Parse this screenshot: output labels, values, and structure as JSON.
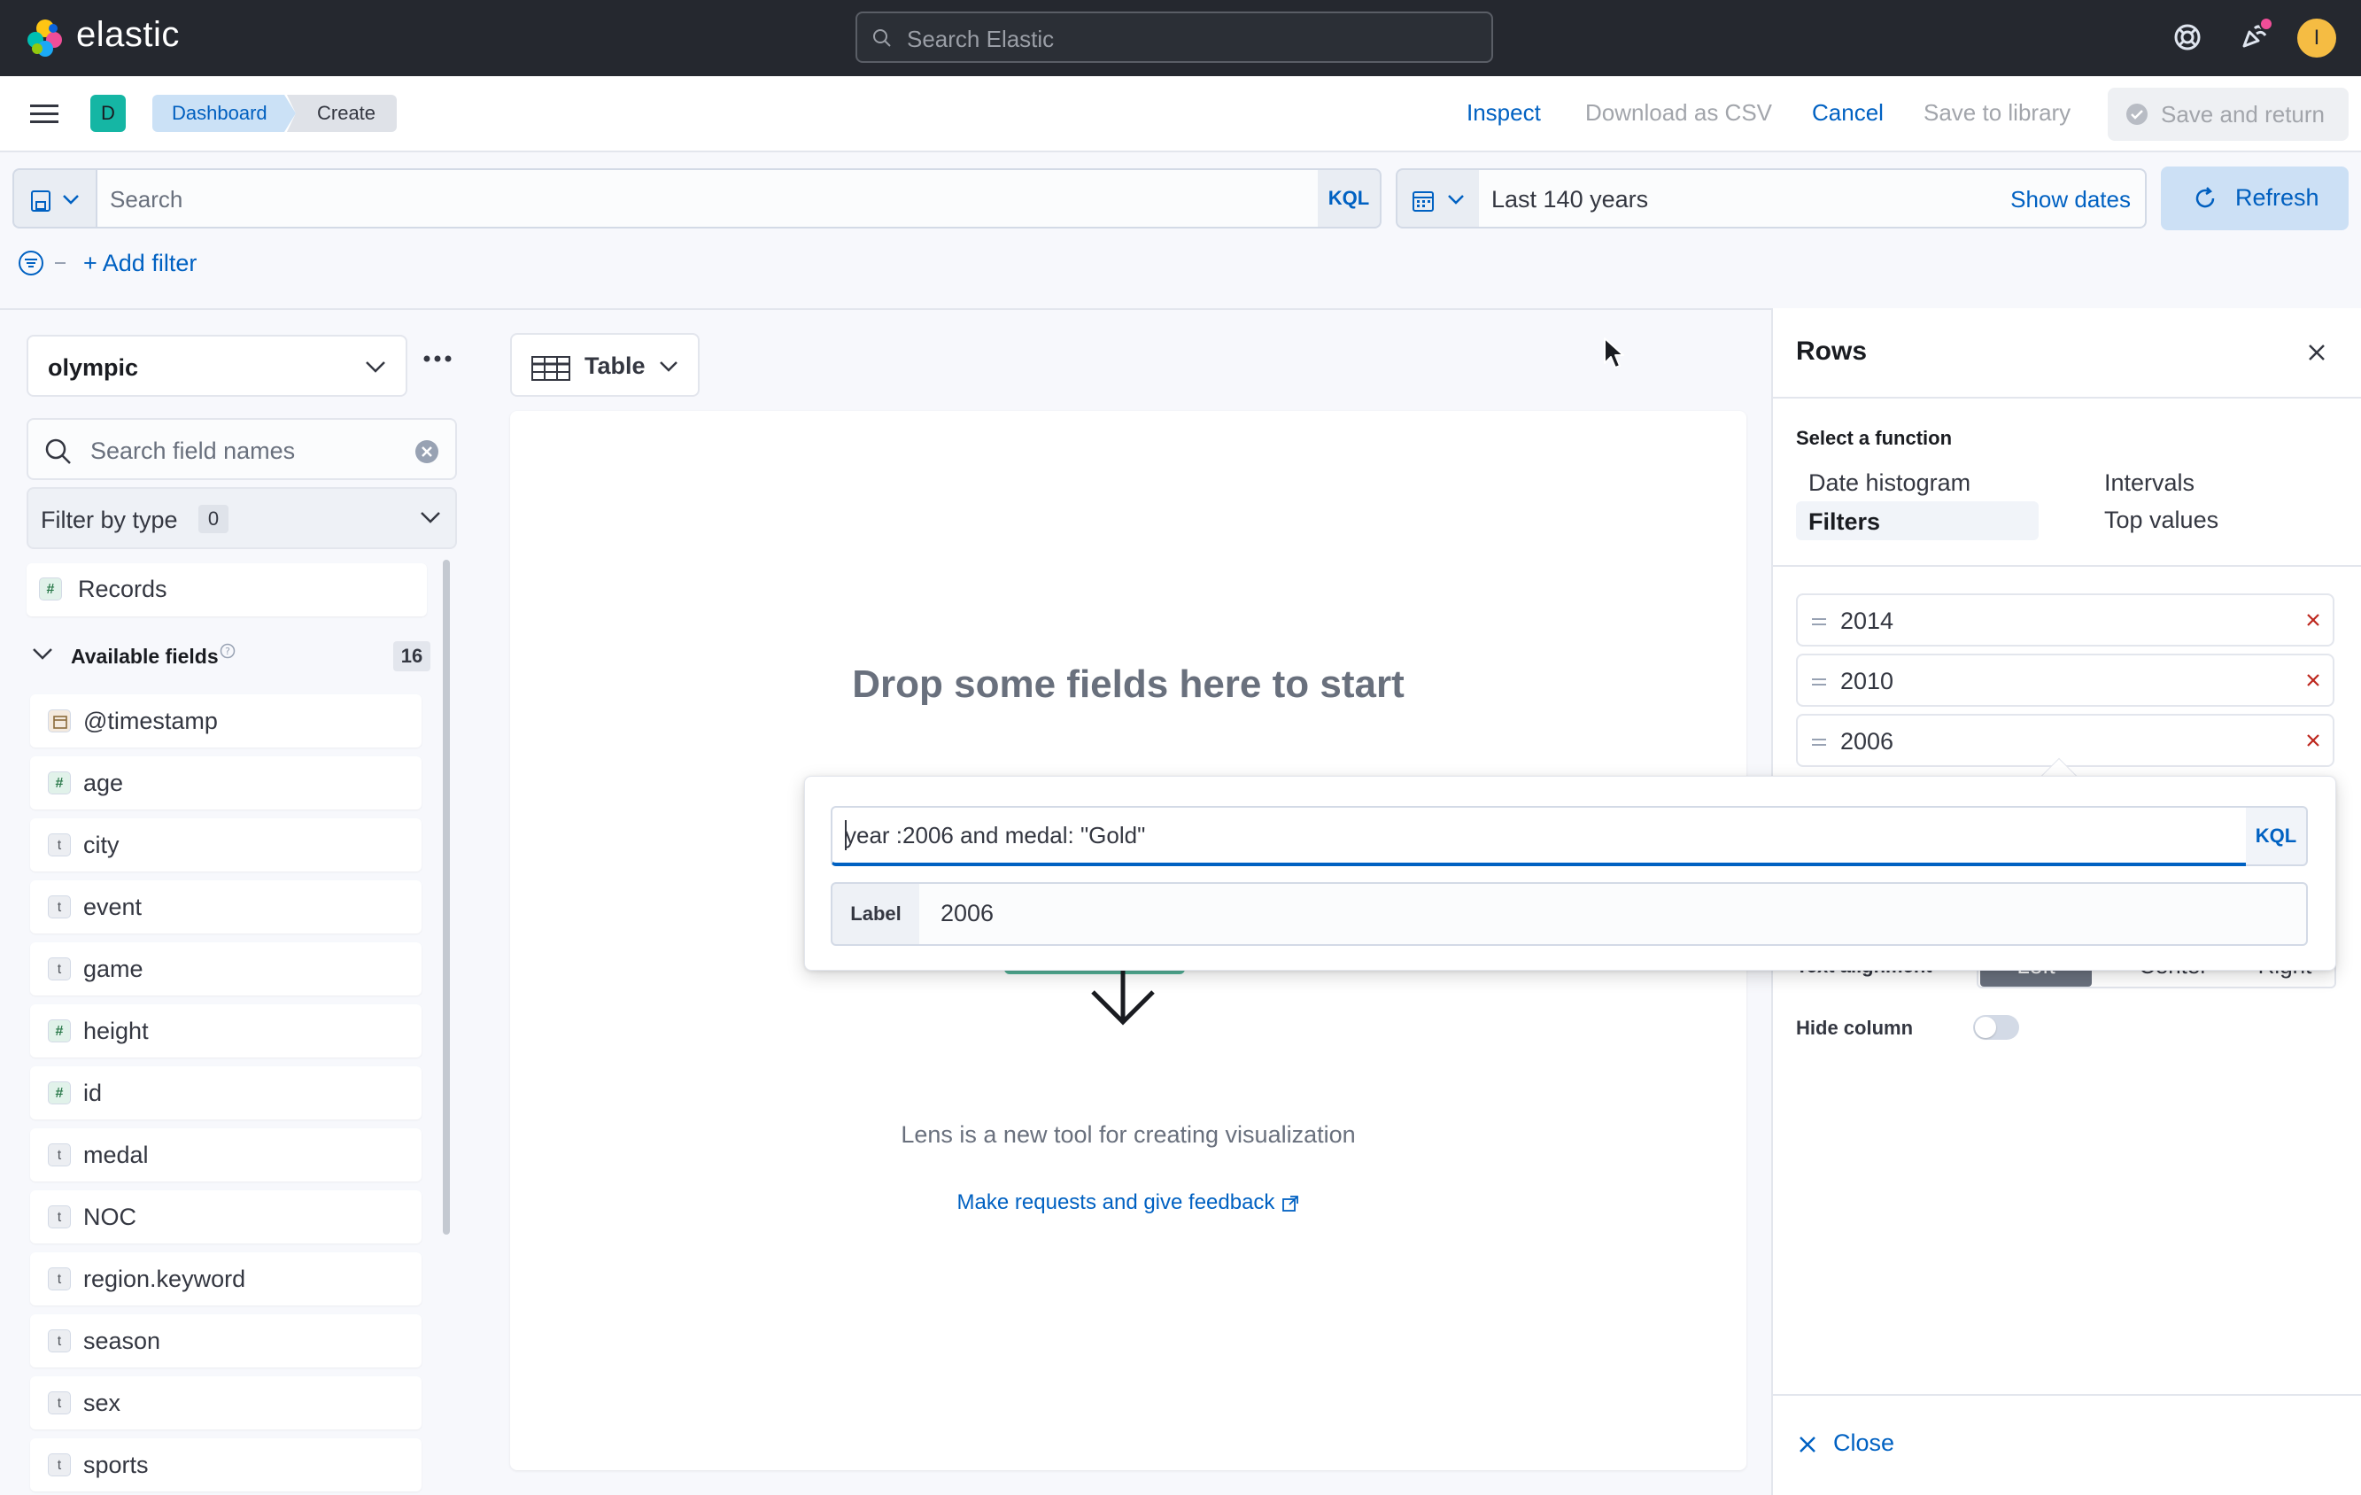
{
  "header": {
    "brand": "elastic",
    "search_placeholder": "Search Elastic",
    "avatar_initial": "I"
  },
  "appbar": {
    "space_initial": "D",
    "breadcrumbs": [
      "Dashboard",
      "Create"
    ],
    "actions": {
      "inspect": "Inspect",
      "download_csv": "Download as CSV",
      "cancel": "Cancel",
      "save_to_library": "Save to library",
      "save_and_return": "Save and return"
    }
  },
  "querybar": {
    "search_placeholder": "Search",
    "language": "KQL",
    "date_range": "Last 140 years",
    "show_dates": "Show dates",
    "refresh": "Refresh",
    "add_filter": "+ Add filter"
  },
  "sidebar": {
    "index_pattern": "olympic",
    "field_search_placeholder": "Search field names",
    "filter_by_type": "Filter by type",
    "filter_count": "0",
    "records": "Records",
    "available_fields_label": "Available fields",
    "available_fields_count": "16",
    "fields": [
      {
        "name": "@timestamp",
        "type": "date"
      },
      {
        "name": "age",
        "type": "number"
      },
      {
        "name": "city",
        "type": "string"
      },
      {
        "name": "event",
        "type": "string"
      },
      {
        "name": "game",
        "type": "string"
      },
      {
        "name": "height",
        "type": "number"
      },
      {
        "name": "id",
        "type": "number"
      },
      {
        "name": "medal",
        "type": "string"
      },
      {
        "name": "NOC",
        "type": "string"
      },
      {
        "name": "region.keyword",
        "type": "string"
      },
      {
        "name": "season",
        "type": "string"
      },
      {
        "name": "sex",
        "type": "string"
      },
      {
        "name": "sports",
        "type": "string"
      }
    ]
  },
  "workspace": {
    "viz_type": "Table",
    "drop_title": "Drop some fields here to start",
    "description": "Lens is a new tool for creating visualization",
    "feedback_link": "Make requests and give feedback"
  },
  "flyout": {
    "title": "Rows",
    "select_function_label": "Select a function",
    "functions": {
      "date_histogram": "Date histogram",
      "filters": "Filters",
      "intervals": "Intervals",
      "top_values": "Top values"
    },
    "selected_function": "Filters",
    "filters": [
      "2014",
      "2010",
      "2006"
    ],
    "text_alignment_label": "Text alignment",
    "alignment_options": [
      "Left",
      "Center",
      "Right"
    ],
    "selected_alignment": "Left",
    "hide_column_label": "Hide column",
    "hide_column": false,
    "close": "Close"
  },
  "popover": {
    "query": "year :2006 and medal: \"Gold\"",
    "language": "KQL",
    "label_prepend": "Label",
    "label_value": "2006"
  },
  "colors": {
    "header_bg": "#25282f",
    "link_blue": "#0061c2",
    "refresh_bg": "#cce0f5",
    "remove_red": "#bd271e",
    "space_badge": "#15b6a4",
    "avatar": "#f5bc43"
  },
  "icons": {
    "logo": "elastic-logo-icon",
    "search": "search-icon",
    "help": "help-icon",
    "news": "newsfeed-icon",
    "menu": "menu-icon",
    "calendar": "calendar-icon",
    "refresh": "refresh-icon",
    "filter": "filter-icon",
    "table": "table-icon",
    "close": "close-icon"
  }
}
